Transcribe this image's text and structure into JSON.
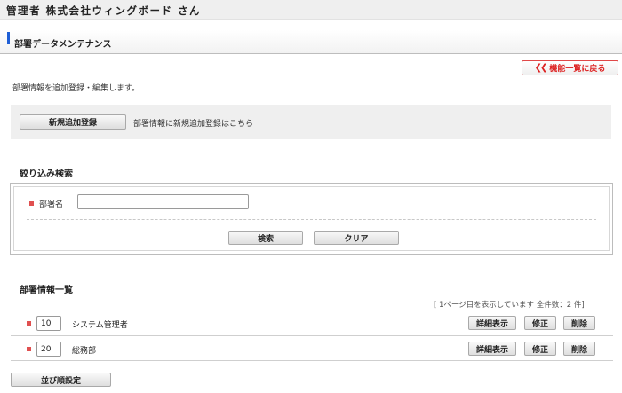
{
  "header": {
    "title": "管理者 株式会社ウィングボード さん"
  },
  "page": {
    "title": "部署データメンテナンス"
  },
  "back_button": {
    "icon": "double-chevron-left",
    "label": "機能一覧に戻る"
  },
  "description": "部署情報を追加登録・編集します。",
  "add_section": {
    "button_label": "新規追加登録",
    "text": "部署情報に新規追加登録はこちら"
  },
  "filter": {
    "heading": "絞り込み検索",
    "field_label": "部署名",
    "field_value": "",
    "search_label": "検索",
    "clear_label": "クリア"
  },
  "list": {
    "heading": "部署情報一覧",
    "count_text": "[ 1ページ目を表示しています 全件数：2 件]",
    "rows": [
      {
        "code": "10",
        "name": "システム管理者"
      },
      {
        "code": "20",
        "name": "総務部"
      }
    ],
    "detail_label": "詳細表示",
    "edit_label": "修正",
    "delete_label": "削除"
  },
  "sort_button": "並び順設定",
  "colors": {
    "accent_blue": "#1f5fd6",
    "accent_red": "#e05050",
    "panel_gray": "#efefef"
  }
}
